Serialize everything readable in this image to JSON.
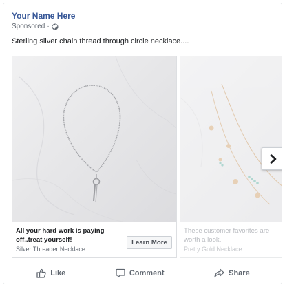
{
  "post": {
    "page_name": "Your Name Here",
    "sponsored_label": "Sponsored",
    "separator": "·",
    "text": "Sterling silver chain thread through circle necklace...."
  },
  "carousel": {
    "cards": [
      {
        "headline": "All your hard work is paying off..treat yourself!",
        "description": "Silver Threader Necklace",
        "cta_label": "Learn More",
        "image": "silver-threader-necklace-photo"
      },
      {
        "headline": "These customer favorites are worth a look.",
        "description": "Pretty Gold Necklace",
        "image": "pretty-gold-necklace-photo"
      }
    ],
    "next_icon": "chevron-right-icon"
  },
  "actions": {
    "like_label": "Like",
    "comment_label": "Comment",
    "share_label": "Share"
  },
  "colors": {
    "page_name": "#385898",
    "secondary_text": "#606770",
    "border": "#dddfe2",
    "marble_background": "#e9e9eb"
  }
}
